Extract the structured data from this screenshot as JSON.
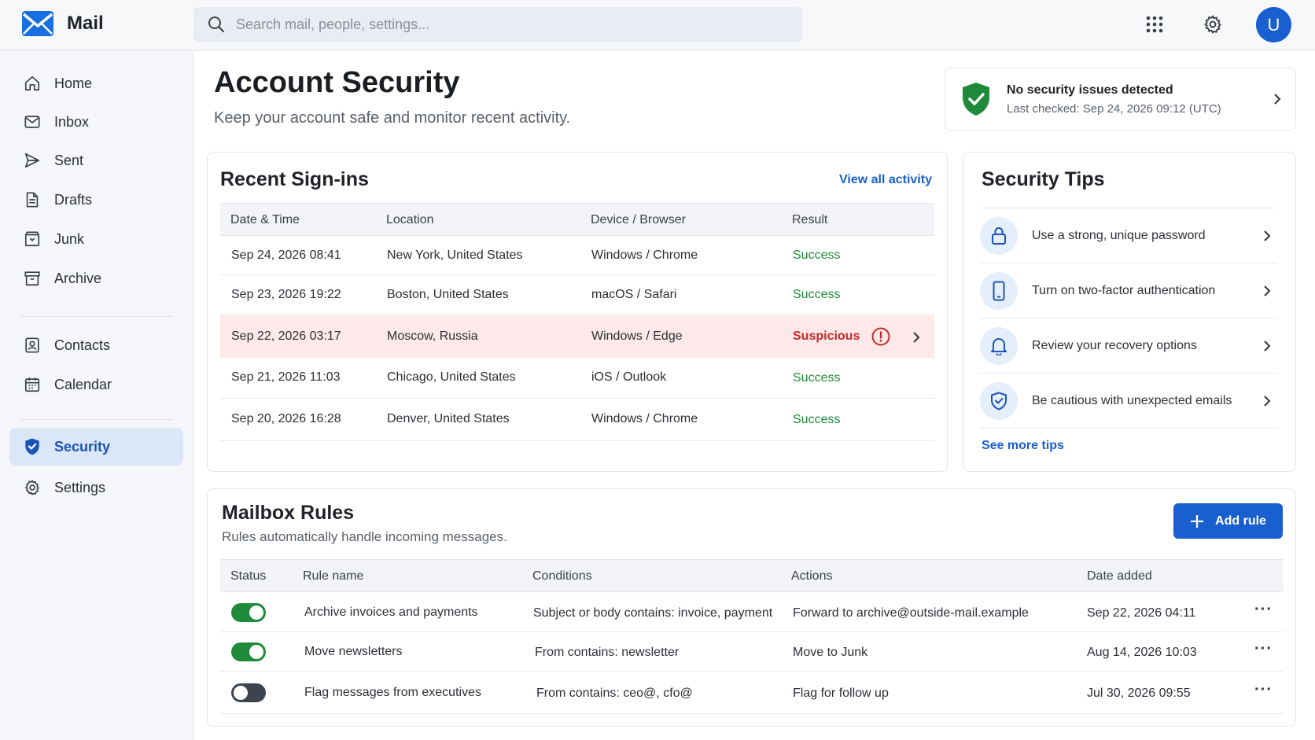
{
  "app": {
    "name": "Mail",
    "avatar_initial": "U"
  },
  "search": {
    "placeholder": "Search mail, people, settings..."
  },
  "sidebar": {
    "items": [
      {
        "label": "Home",
        "icon": "home-icon"
      },
      {
        "label": "Inbox",
        "icon": "inbox-icon"
      },
      {
        "label": "Sent",
        "icon": "send-icon"
      },
      {
        "label": "Drafts",
        "icon": "draft-icon"
      },
      {
        "label": "Junk",
        "icon": "junk-icon"
      },
      {
        "label": "Archive",
        "icon": "archive-icon"
      },
      {
        "label": "Contacts",
        "icon": "contacts-icon"
      },
      {
        "label": "Calendar",
        "icon": "calendar-icon"
      },
      {
        "label": "Security",
        "icon": "shield-icon",
        "active": true
      },
      {
        "label": "Settings",
        "icon": "gear-icon"
      }
    ]
  },
  "page": {
    "title": "Account Security",
    "subtitle": "Keep your account safe and monitor recent activity."
  },
  "banner": {
    "title": "No security issues detected",
    "subtitle": "Last checked: Sep 24, 2026 09:12 (UTC)"
  },
  "signins": {
    "title": "Recent Sign-ins",
    "view_all": "View all activity",
    "columns": [
      "Date & Time",
      "Location",
      "Device / Browser",
      "Result"
    ],
    "rows": [
      {
        "datetime": "Sep 24, 2026  08:41",
        "location": "New York, United States",
        "device": "Windows / Chrome",
        "result": "Success"
      },
      {
        "datetime": "Sep 23, 2026  19:22",
        "location": "Boston, United States",
        "device": "macOS / Safari",
        "result": "Success"
      },
      {
        "datetime": "Sep 22, 2026  03:17",
        "location": "Moscow, Russia",
        "device": "Windows / Edge",
        "result": "Suspicious"
      },
      {
        "datetime": "Sep 21, 2026  11:03",
        "location": "Chicago, United States",
        "device": "iOS / Outlook",
        "result": "Success"
      },
      {
        "datetime": "Sep 20, 2026  16:28",
        "location": "Denver, United States",
        "device": "Windows / Chrome",
        "result": "Success"
      }
    ]
  },
  "tips": {
    "title": "Security Tips",
    "items": [
      {
        "label": "Use a strong, unique password",
        "icon": "lock-icon"
      },
      {
        "label": "Turn on two-factor authentication",
        "icon": "phone-icon"
      },
      {
        "label": "Review your recovery options",
        "icon": "bell-icon"
      },
      {
        "label": "Be cautious with unexpected emails",
        "icon": "shield-check-icon"
      }
    ],
    "more": "See more tips"
  },
  "rules": {
    "title": "Mailbox Rules",
    "subtitle": "Rules automatically handle incoming messages.",
    "add_label": "Add rule",
    "columns": [
      "Status",
      "Rule name",
      "Conditions",
      "Actions",
      "Date added"
    ],
    "rows": [
      {
        "enabled": true,
        "name": "Archive invoices and payments",
        "conditions": "Subject or body contains: invoice, payment",
        "actions": "Forward to archive@outside-mail.example",
        "date": "Sep 22, 2026  04:11"
      },
      {
        "enabled": true,
        "name": "Move newsletters",
        "conditions": "From contains: newsletter",
        "actions": "Move to Junk",
        "date": "Aug 14, 2026  10:03"
      },
      {
        "enabled": false,
        "name": "Flag messages from executives",
        "conditions": "From contains: ceo@, cfo@",
        "actions": "Flag for follow up",
        "date": "Jul 30, 2026  09:55"
      }
    ]
  },
  "colors": {
    "accent": "#1a5fd0",
    "success": "#1f8a3a",
    "danger": "#c42b2b",
    "suspicious_row": "#fde9e9"
  }
}
